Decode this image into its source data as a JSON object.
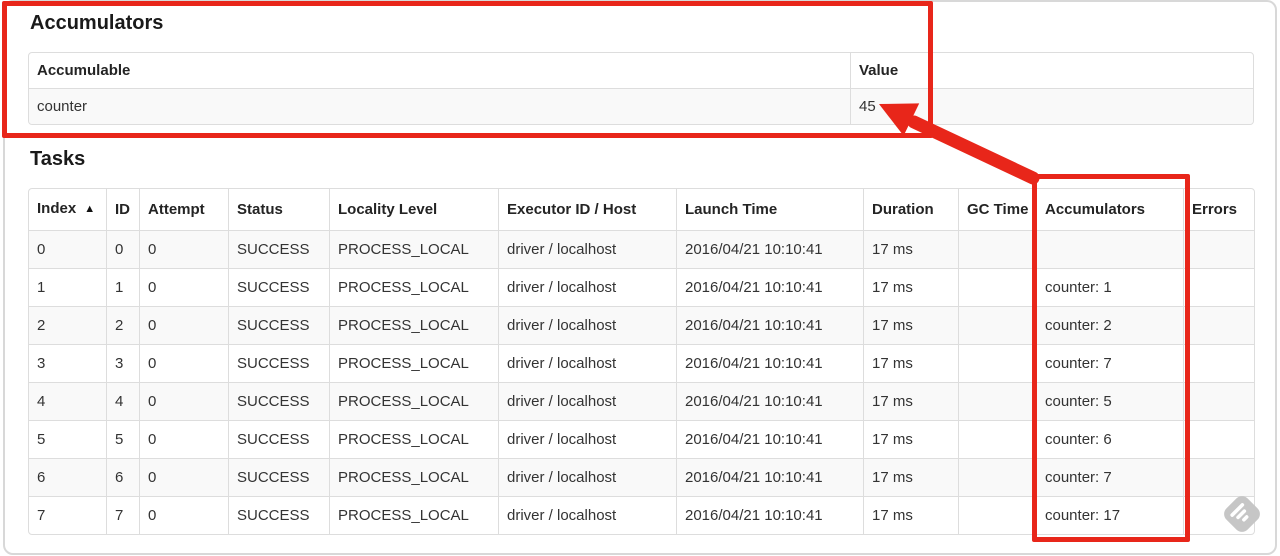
{
  "accumulators": {
    "title": "Accumulators",
    "columns": [
      "Accumulable",
      "Value"
    ],
    "rows": [
      {
        "accumulable": "counter",
        "value": "45"
      }
    ]
  },
  "tasks": {
    "title": "Tasks",
    "columns": [
      "Index",
      "ID",
      "Attempt",
      "Status",
      "Locality Level",
      "Executor ID / Host",
      "Launch Time",
      "Duration",
      "GC Time",
      "Accumulators",
      "Errors"
    ],
    "sort": {
      "column": "Index",
      "direction": "ascending",
      "indicator": "▲"
    },
    "rows": [
      {
        "index": "0",
        "id": "0",
        "attempt": "0",
        "status": "SUCCESS",
        "locality_level": "PROCESS_LOCAL",
        "executor_id_host": "driver / localhost",
        "launch_time": "2016/04/21 10:10:41",
        "duration": "17 ms",
        "gc_time": "",
        "accumulators": "",
        "errors": ""
      },
      {
        "index": "1",
        "id": "1",
        "attempt": "0",
        "status": "SUCCESS",
        "locality_level": "PROCESS_LOCAL",
        "executor_id_host": "driver / localhost",
        "launch_time": "2016/04/21 10:10:41",
        "duration": "17 ms",
        "gc_time": "",
        "accumulators": "counter: 1",
        "errors": ""
      },
      {
        "index": "2",
        "id": "2",
        "attempt": "0",
        "status": "SUCCESS",
        "locality_level": "PROCESS_LOCAL",
        "executor_id_host": "driver / localhost",
        "launch_time": "2016/04/21 10:10:41",
        "duration": "17 ms",
        "gc_time": "",
        "accumulators": "counter: 2",
        "errors": ""
      },
      {
        "index": "3",
        "id": "3",
        "attempt": "0",
        "status": "SUCCESS",
        "locality_level": "PROCESS_LOCAL",
        "executor_id_host": "driver / localhost",
        "launch_time": "2016/04/21 10:10:41",
        "duration": "17 ms",
        "gc_time": "",
        "accumulators": "counter: 7",
        "errors": ""
      },
      {
        "index": "4",
        "id": "4",
        "attempt": "0",
        "status": "SUCCESS",
        "locality_level": "PROCESS_LOCAL",
        "executor_id_host": "driver / localhost",
        "launch_time": "2016/04/21 10:10:41",
        "duration": "17 ms",
        "gc_time": "",
        "accumulators": "counter: 5",
        "errors": ""
      },
      {
        "index": "5",
        "id": "5",
        "attempt": "0",
        "status": "SUCCESS",
        "locality_level": "PROCESS_LOCAL",
        "executor_id_host": "driver / localhost",
        "launch_time": "2016/04/21 10:10:41",
        "duration": "17 ms",
        "gc_time": "",
        "accumulators": "counter: 6",
        "errors": ""
      },
      {
        "index": "6",
        "id": "6",
        "attempt": "0",
        "status": "SUCCESS",
        "locality_level": "PROCESS_LOCAL",
        "executor_id_host": "driver / localhost",
        "launch_time": "2016/04/21 10:10:41",
        "duration": "17 ms",
        "gc_time": "",
        "accumulators": "counter: 7",
        "errors": ""
      },
      {
        "index": "7",
        "id": "7",
        "attempt": "0",
        "status": "SUCCESS",
        "locality_level": "PROCESS_LOCAL",
        "executor_id_host": "driver / localhost",
        "launch_time": "2016/04/21 10:10:41",
        "duration": "17 ms",
        "gc_time": "",
        "accumulators": "counter: 17",
        "errors": ""
      }
    ]
  },
  "annotations": {
    "highlight_color": "#e8261a"
  },
  "icons": {
    "sort_ascending": "▲",
    "watermark": "feedly-icon"
  }
}
